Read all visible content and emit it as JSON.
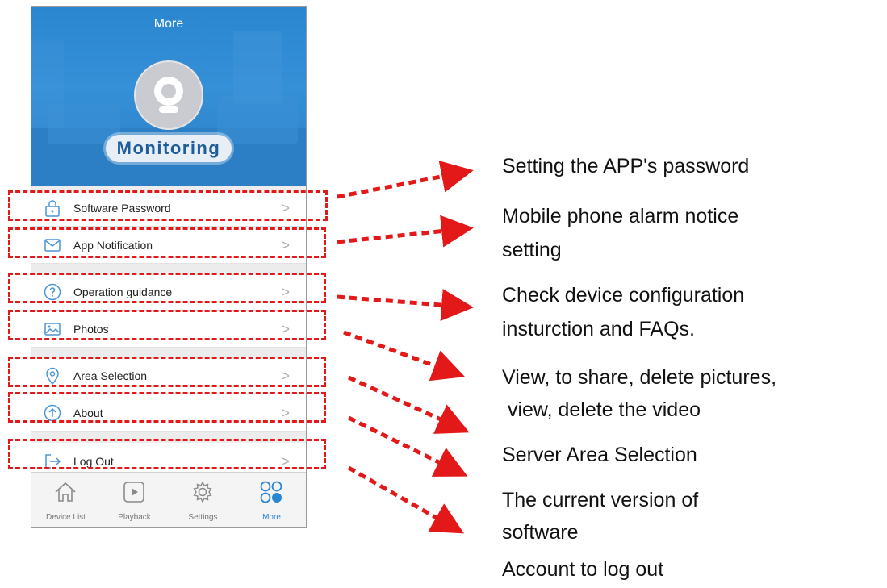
{
  "header": {
    "title": "More",
    "brand": "Monitoring"
  },
  "menu": [
    {
      "label": "Software Password",
      "icon": "lock-icon"
    },
    {
      "label": "App Notification",
      "icon": "mail-icon"
    },
    {
      "label": "Operation guidance",
      "icon": "question-icon"
    },
    {
      "label": "Photos",
      "icon": "image-icon"
    },
    {
      "label": "Area Selection",
      "icon": "location-pin-icon"
    },
    {
      "label": "About",
      "icon": "arrow-up-circle-icon"
    },
    {
      "label": "Log Out",
      "icon": "logout-icon"
    }
  ],
  "chevron": ">",
  "tabs": [
    {
      "label": "Device List",
      "icon": "home-icon",
      "active": false
    },
    {
      "label": "Playback",
      "icon": "play-icon",
      "active": false
    },
    {
      "label": "Settings",
      "icon": "gear-icon",
      "active": false
    },
    {
      "label": "More",
      "icon": "grid-dots-icon",
      "active": true
    }
  ],
  "annotations": [
    "Setting the APP's password",
    "Mobile phone alarm notice",
    "setting",
    "Check device configuration",
    "insturction and FAQs.",
    "View, to share, delete pictures,",
    " view, delete the video",
    "Server Area Selection",
    "The current version of",
    "software",
    "Account to log out"
  ],
  "colors": {
    "accent": "#2b86d1",
    "highlight": "#e31919",
    "brand_text": "#1e5d9c"
  }
}
